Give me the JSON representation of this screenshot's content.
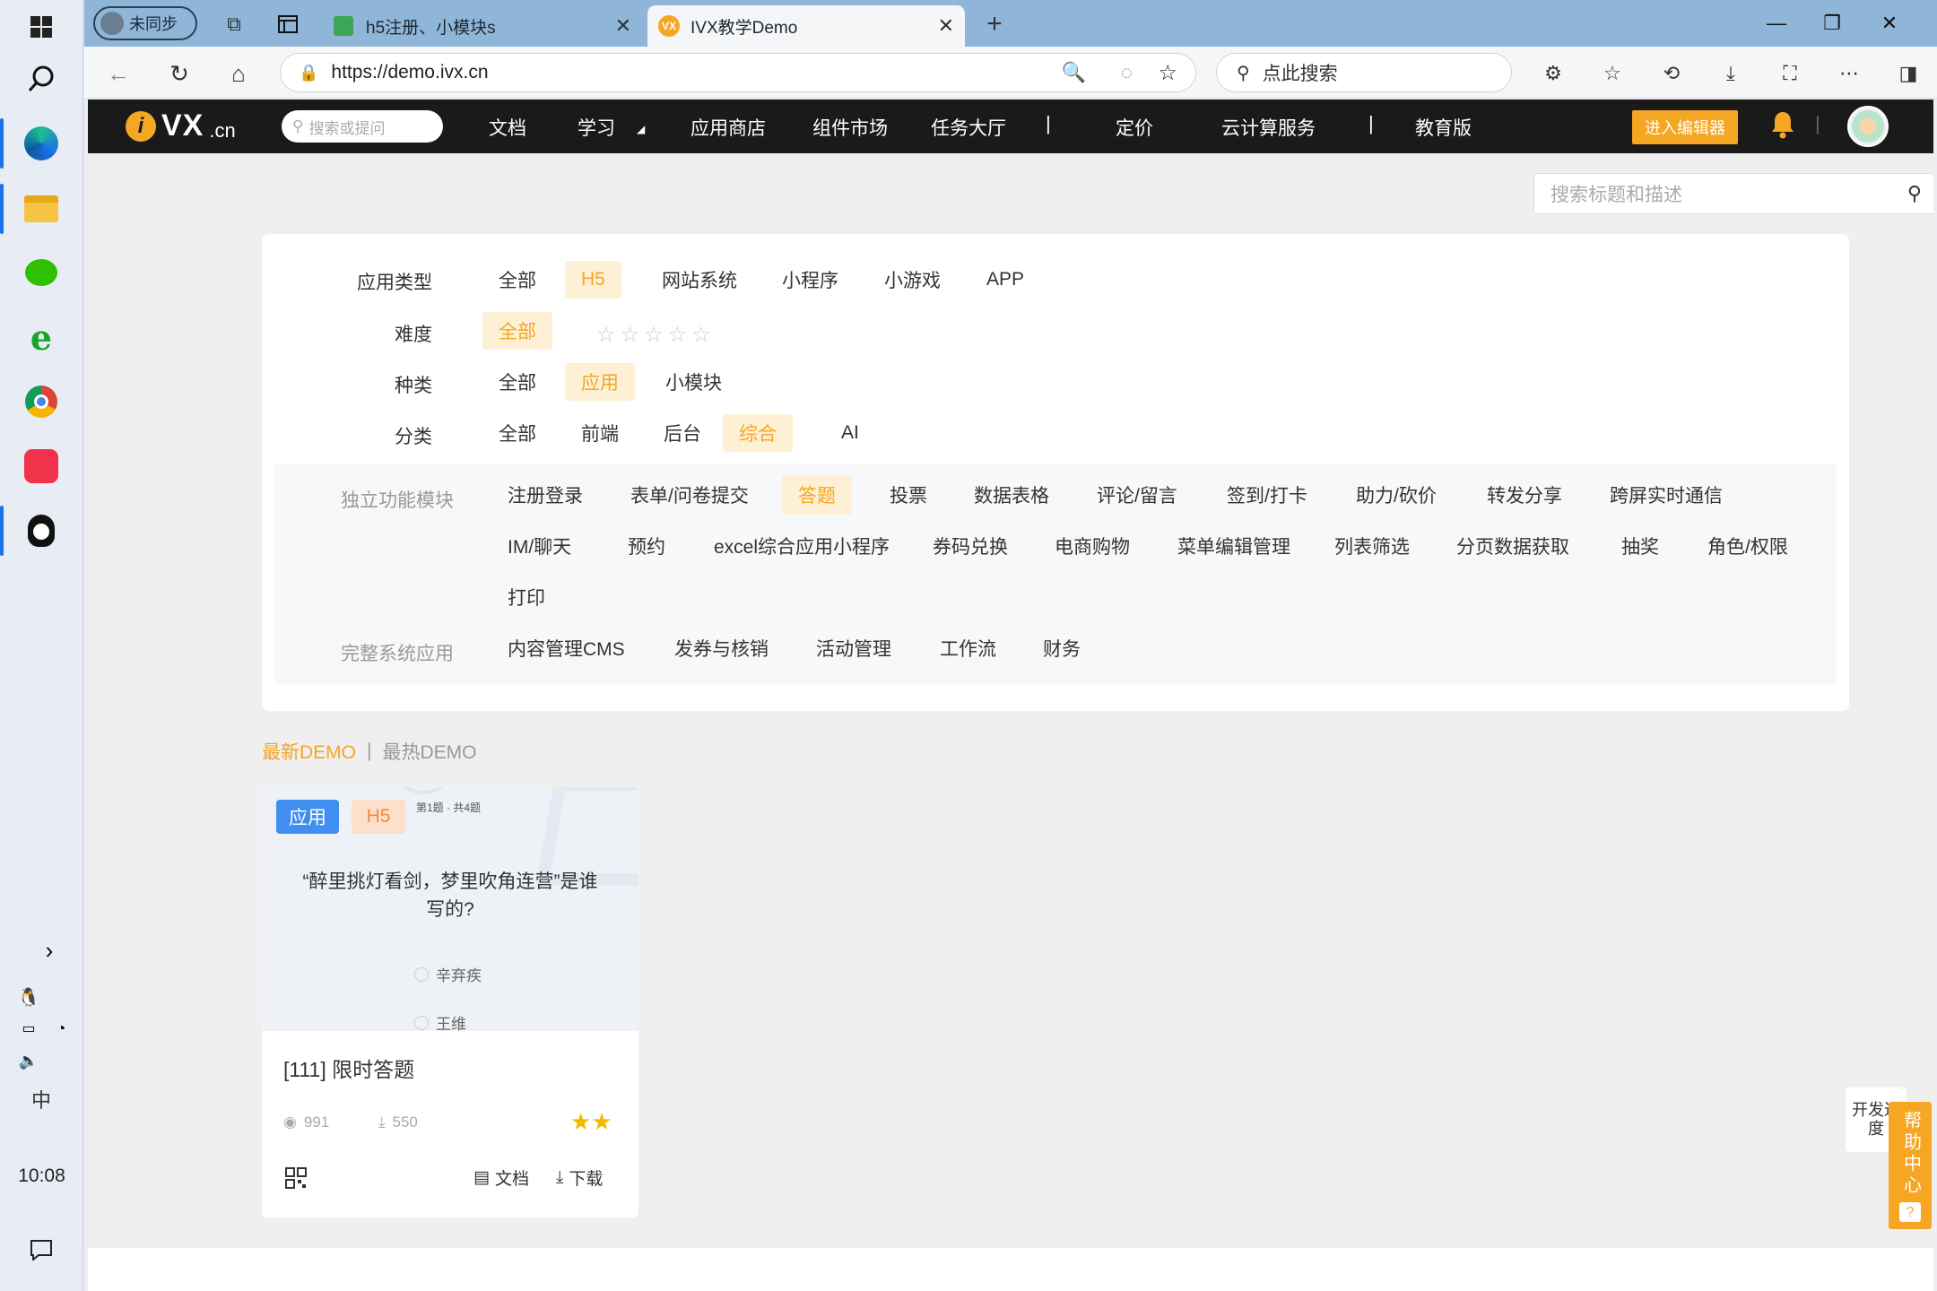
{
  "taskbar": {
    "clock": "10:08",
    "ime": "中"
  },
  "browser": {
    "profile": "未同步",
    "tabs": [
      {
        "title": "h5注册、小模块s"
      },
      {
        "title": "IVX教学Demo"
      }
    ],
    "url": "https://demo.ivx.cn",
    "search_placeholder": "点此搜索"
  },
  "site": {
    "logo": {
      "vx": "VX",
      "cn": ".cn"
    },
    "nav_search_placeholder": "搜索或提问",
    "nav": [
      "文档",
      "学习",
      "应用商店",
      "组件市场",
      "任务大厅",
      "|",
      "定价",
      "云计算服务",
      "|",
      "教育版"
    ],
    "editor_button": "进入编辑器",
    "search_placeholder": "搜索标题和描述",
    "filters": {
      "app_type": {
        "label": "应用类型",
        "options": [
          "全部",
          "H5",
          "网站系统",
          "小程序",
          "小游戏",
          "APP"
        ],
        "selected": "H5"
      },
      "difficulty": {
        "label": "难度",
        "options": [
          "全部"
        ],
        "selected": "全部",
        "stars": 5
      },
      "kind": {
        "label": "种类",
        "options": [
          "全部",
          "应用",
          "小模块"
        ],
        "selected": "应用"
      },
      "category": {
        "label": "分类",
        "options": [
          "全部",
          "前端",
          "后台",
          "综合",
          "AI"
        ],
        "selected": "综合"
      }
    },
    "sub": {
      "independent_label": "独立功能模块",
      "independent": [
        "注册登录",
        "表单/问卷提交",
        "答题",
        "投票",
        "数据表格",
        "评论/留言",
        "签到/打卡",
        "助力/砍价",
        "转发分享",
        "跨屏实时通信",
        "IM/聊天",
        "预约",
        "excel综合应用小程序",
        "券码兑换",
        "电商购物",
        "菜单编辑管理",
        "列表筛选",
        "分页数据获取",
        "抽奖",
        "角色/权限",
        "打印"
      ],
      "independent_selected": "答题",
      "complete_label": "完整系统应用",
      "complete": [
        "内容管理CMS",
        "发券与核销",
        "活动管理",
        "工作流",
        "财务"
      ]
    },
    "sort": {
      "latest": "最新DEMO",
      "sep": "|",
      "hottest": "最热DEMO"
    },
    "card": {
      "badge_kind": "应用",
      "badge_type": "H5",
      "progress": "第1题 · 共4题",
      "question": "“醉里挑灯看剑，梦里吹角连营”是谁写的?",
      "opt1": "辛弃疾",
      "opt2": "王维",
      "title": "[111] 限时答题",
      "views": "991",
      "downloads": "550",
      "stars": 2,
      "doc": "文档",
      "download": "下载"
    },
    "float_dev": "开发进度",
    "help": "帮助中心"
  }
}
